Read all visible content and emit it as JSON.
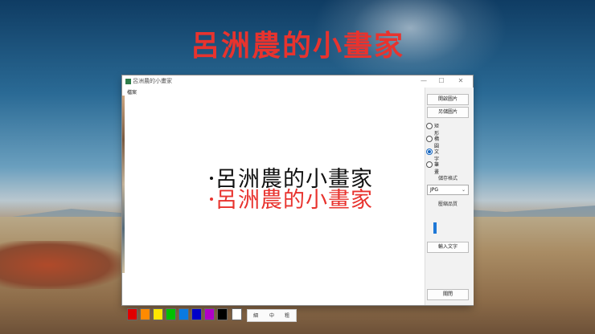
{
  "banner": {
    "title": "呂洲農的小畫家",
    "color": "#e8332e"
  },
  "window": {
    "title": "呂洲農的小畫家",
    "controls": {
      "minimize": "—",
      "maximize": "☐",
      "close": "✕"
    }
  },
  "menu": {
    "file": "檔案"
  },
  "canvas": {
    "lines": [
      {
        "text": "呂洲農的小畫家",
        "color": "#111111"
      },
      {
        "text": "呂洲農的小畫家",
        "color": "#e8332e"
      }
    ]
  },
  "palette": {
    "colors": [
      "#e00000",
      "#ff8a00",
      "#ffe600",
      "#00c000",
      "#0a7ae0",
      "#0000c8",
      "#b000c8",
      "#000000",
      "#ffffff"
    ],
    "sizes": [
      "細",
      "中",
      "粗"
    ]
  },
  "panel": {
    "open_label": "開啟圖片",
    "save_as_label": "另儲圖片",
    "tools": [
      {
        "label": "矩形",
        "selected": false
      },
      {
        "label": "橢圓",
        "selected": false
      },
      {
        "label": "文字",
        "selected": true
      },
      {
        "label": "筆畫",
        "selected": false
      }
    ],
    "format_label": "儲存格式",
    "format_value": "JPG",
    "quality_label": "壓縮品質",
    "input_text_label": "輸入文字",
    "close_label": "關閉"
  }
}
